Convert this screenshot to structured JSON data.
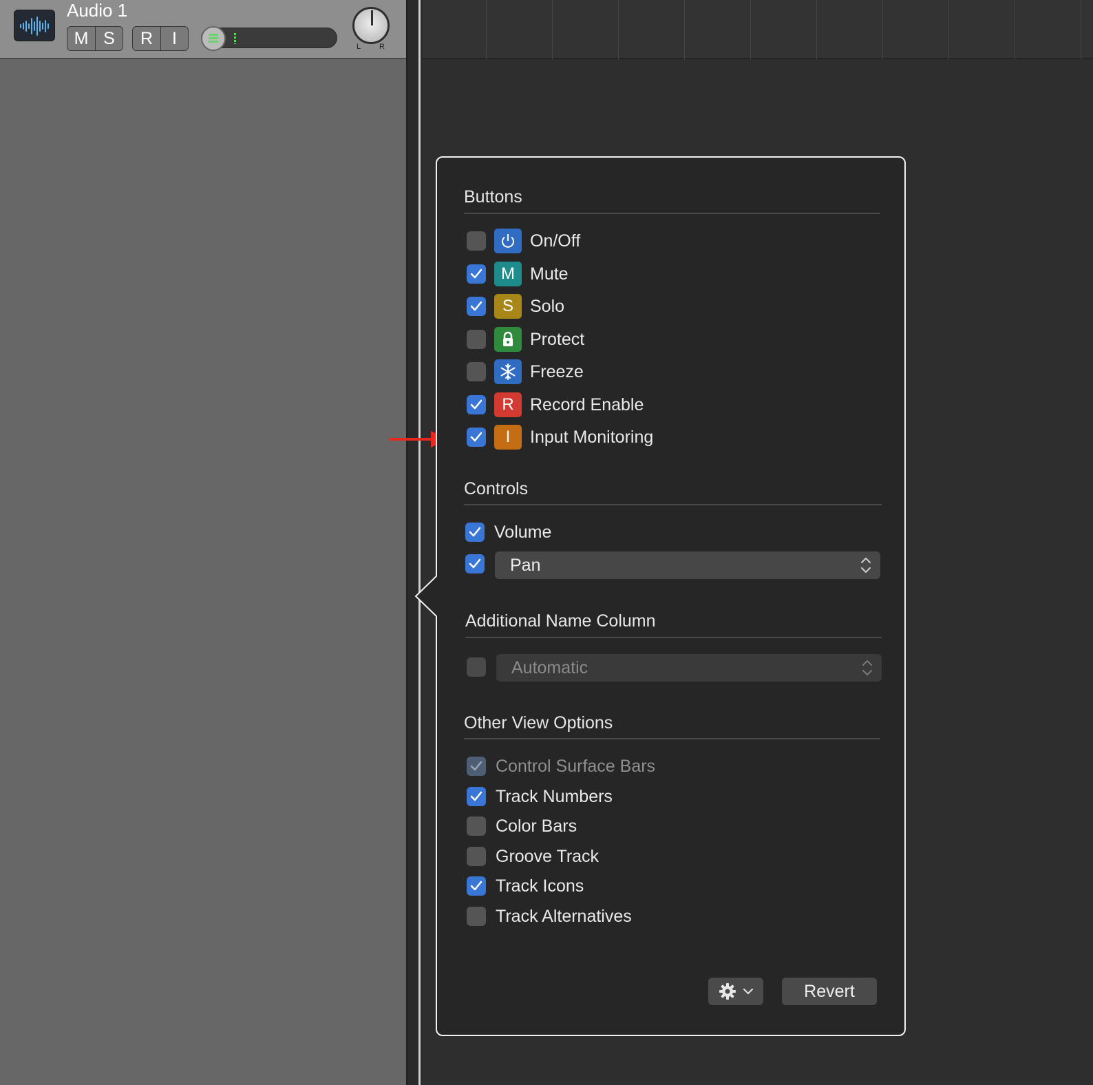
{
  "track": {
    "name": "Audio 1",
    "buttons": {
      "mute": "M",
      "solo": "S",
      "record": "R",
      "input": "I"
    },
    "pan_left": "L",
    "pan_right": "R"
  },
  "popover": {
    "buttons_section": {
      "title": "Buttons",
      "items": [
        {
          "label": "On/Off",
          "checked": false,
          "icon": "power-icon",
          "badge_color": "#2f6cc2"
        },
        {
          "label": "Mute",
          "checked": true,
          "icon": "M",
          "badge_color": "#1f8c8c"
        },
        {
          "label": "Solo",
          "checked": true,
          "icon": "S",
          "badge_color": "#a88718"
        },
        {
          "label": "Protect",
          "checked": false,
          "icon": "lock-icon",
          "badge_color": "#2f8a3c"
        },
        {
          "label": "Freeze",
          "checked": false,
          "icon": "snowflake-icon",
          "badge_color": "#2f6cc2"
        },
        {
          "label": "Record Enable",
          "checked": true,
          "icon": "R",
          "badge_color": "#d33a32"
        },
        {
          "label": "Input Monitoring",
          "checked": true,
          "icon": "I",
          "badge_color": "#c46d14"
        }
      ]
    },
    "controls_section": {
      "title": "Controls",
      "volume": {
        "label": "Volume",
        "checked": true
      },
      "pan": {
        "checked": true,
        "selected": "Pan"
      }
    },
    "additional_name_column": {
      "title": "Additional Name Column",
      "checked": false,
      "selected": "Automatic"
    },
    "other_view_options": {
      "title": "Other View Options",
      "items": [
        {
          "label": "Control Surface Bars",
          "checked": true,
          "disabled": true
        },
        {
          "label": "Track Numbers",
          "checked": true,
          "disabled": false
        },
        {
          "label": "Color Bars",
          "checked": false,
          "disabled": false
        },
        {
          "label": "Groove Track",
          "checked": false,
          "disabled": false
        },
        {
          "label": "Track Icons",
          "checked": true,
          "disabled": false
        },
        {
          "label": "Track Alternatives",
          "checked": false,
          "disabled": false
        }
      ]
    },
    "footer": {
      "revert_label": "Revert",
      "gear_icon": "gear-icon"
    }
  },
  "colors": {
    "accent": "#3a76d6",
    "annotation_arrow": "#e8281e"
  }
}
